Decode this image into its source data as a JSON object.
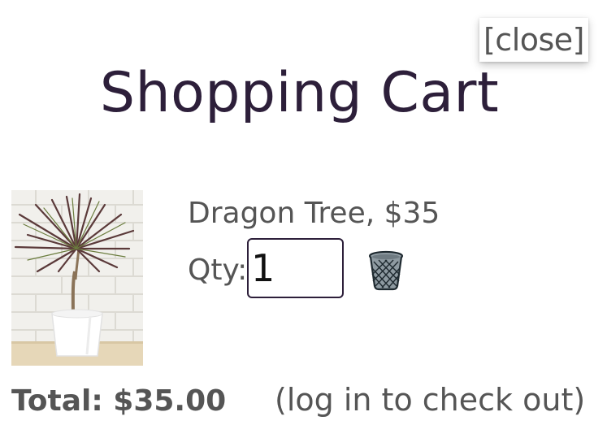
{
  "cart": {
    "close_label": "[close]",
    "title": "Shopping Cart",
    "items": [
      {
        "name_price": "Dragon Tree, $35",
        "qty_label": "Qty:",
        "quantity": "1",
        "image_icon": "dragon-tree-plant-photo"
      }
    ],
    "total_label": "Total: $35.00",
    "checkout_text": "(log in to check out)"
  },
  "colors": {
    "title": "#2d1f3a",
    "text": "#555555",
    "input_border": "#2d1f3a",
    "background": "#ffffff"
  },
  "icons": {
    "trash": "trash-can-icon",
    "product": "plant-photo"
  }
}
